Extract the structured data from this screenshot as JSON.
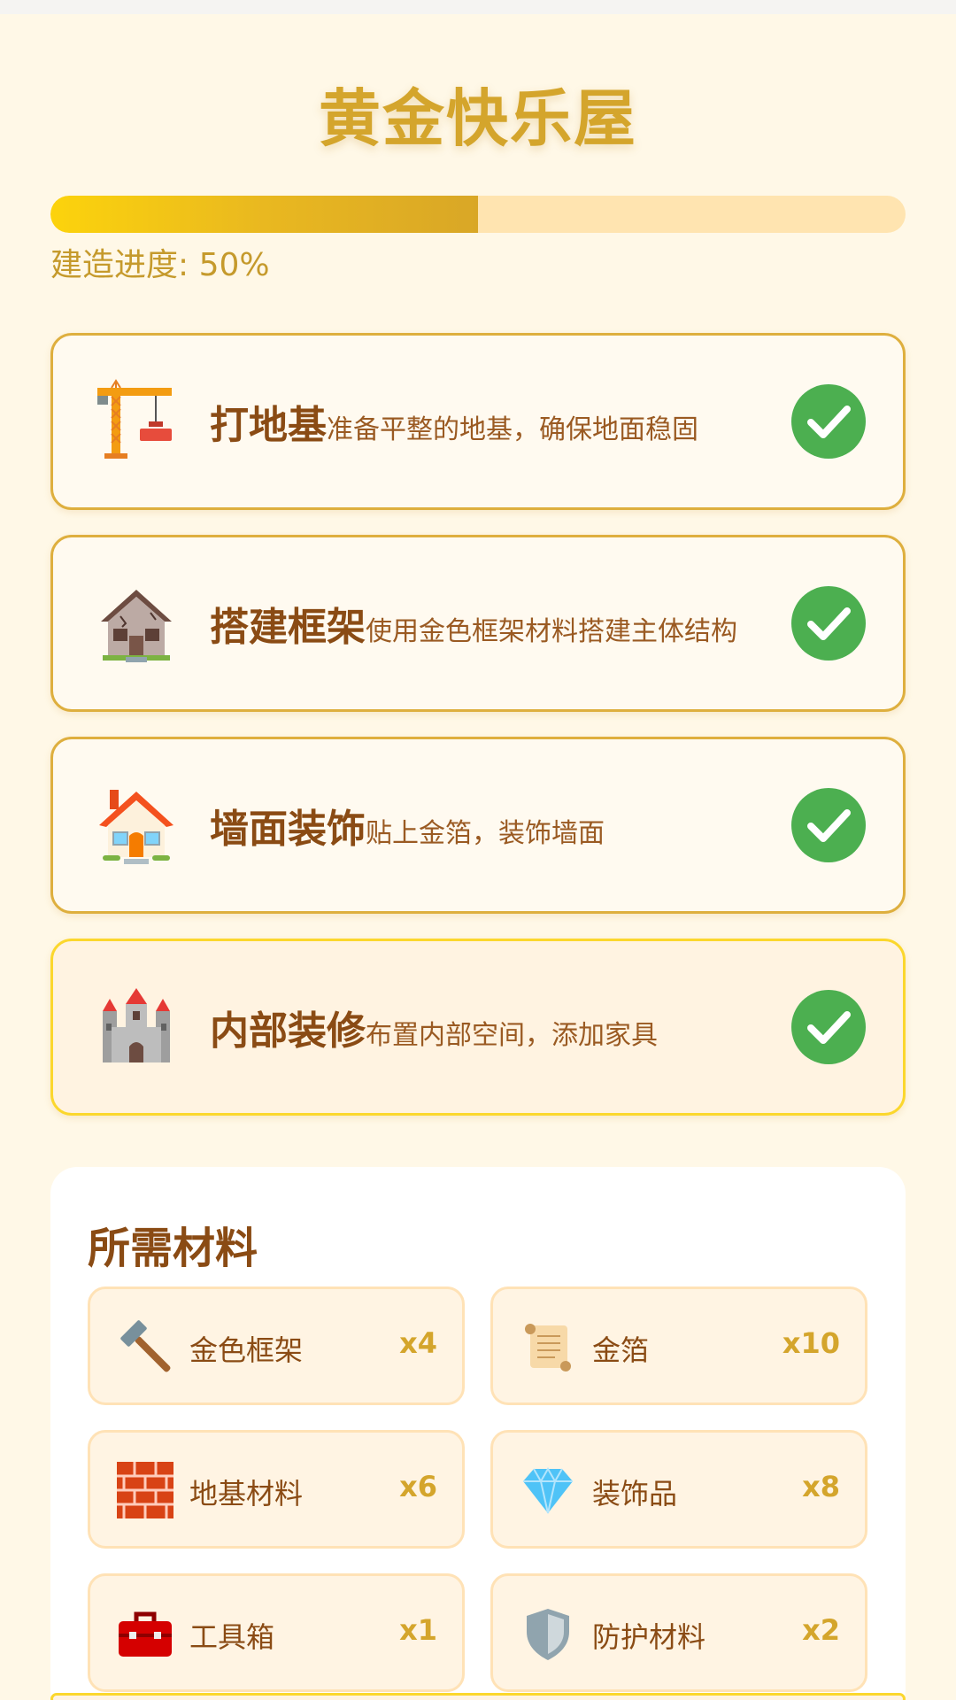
{
  "header": {
    "title": "黄金快乐屋"
  },
  "progress": {
    "label": "建造进度: 50%",
    "value": 0.5
  },
  "steps": [
    {
      "name": "打地基",
      "desc": "准备平整的地基，确保地面稳固",
      "icon": "construction-crane-icon",
      "done": true
    },
    {
      "name": "搭建框架",
      "desc": "使用金色框架材料搭建主体结构",
      "icon": "derelict-house-icon",
      "done": true
    },
    {
      "name": "墙面装饰",
      "desc": "贴上金箔，装饰墙面",
      "icon": "house-icon",
      "done": true
    },
    {
      "name": "内部装修",
      "desc": "布置内部空间，添加家具",
      "icon": "castle-icon",
      "done": true
    }
  ],
  "materials": {
    "title": "所需材料",
    "items": [
      {
        "name": "金色框架",
        "qty": "x4",
        "icon": "hammer-icon"
      },
      {
        "name": "金箔",
        "qty": "x10",
        "icon": "scroll-icon"
      },
      {
        "name": "地基材料",
        "qty": "x6",
        "icon": "brick-icon"
      },
      {
        "name": "装饰品",
        "qty": "x8",
        "icon": "gem-icon"
      },
      {
        "name": "工具箱",
        "qty": "x1",
        "icon": "toolbox-icon"
      },
      {
        "name": "防护材料",
        "qty": "x2",
        "icon": "shield-icon"
      }
    ]
  },
  "colors": {
    "accent": "#d4a52c",
    "text": "#8a4b14",
    "check": "#4caf50",
    "active_border": "#fbd72d"
  }
}
